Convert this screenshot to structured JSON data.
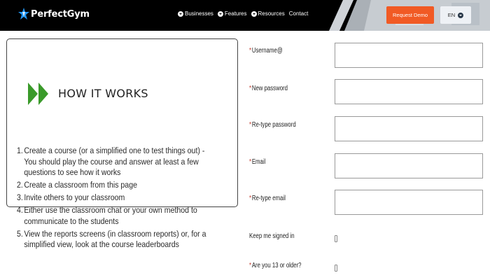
{
  "header": {
    "brand": "PerfectGym",
    "nav": [
      {
        "label": "Businesses",
        "icon": "chevron-down-icon"
      },
      {
        "label": "Features",
        "icon": "chevron-down-icon"
      },
      {
        "label": "Resources",
        "icon": "chevron-down-icon"
      },
      {
        "label": "Contact"
      }
    ],
    "cta_label": "Request Demo",
    "lang_label": "EN",
    "colors": {
      "cta": "#f15a24",
      "brand_icon": "#2196f3",
      "bar": "#000000"
    }
  },
  "info": {
    "title": "HOW IT WORKS",
    "icon": "fast-forward-icon",
    "icon_color": "#3a9a2a",
    "steps": [
      {
        "num": "1.",
        "text": "Create a course (or a simplified one to test things out) - You should play the course and answer at least a few questions to see how it works"
      },
      {
        "num": "2.",
        "text": "Create a classroom from this page"
      },
      {
        "num": "3.",
        "text": "Invite others to your classroom"
      },
      {
        "num": "4.",
        "text": "Either use the classroom chat or your own method to communicate to the students"
      },
      {
        "num": "5.",
        "text": "View the reports screens (in classroom reports) or, for a simplified view, look at the course leaderboards"
      }
    ]
  },
  "form": {
    "required_mark": "*",
    "username_label": "Username",
    "username_help_icon": "@",
    "new_password_label": "New password",
    "retype_password_label": "Re-type password",
    "email_label": "Email",
    "retype_email_label": "Re-type email",
    "keep_signed_label": "Keep me signed in",
    "age_label": "Are you 13 or older?",
    "username_value": "",
    "new_password_value": "",
    "retype_password_value": "",
    "email_value": "",
    "retype_email_value": "",
    "keep_signed_checked": false,
    "age_checked": false
  }
}
